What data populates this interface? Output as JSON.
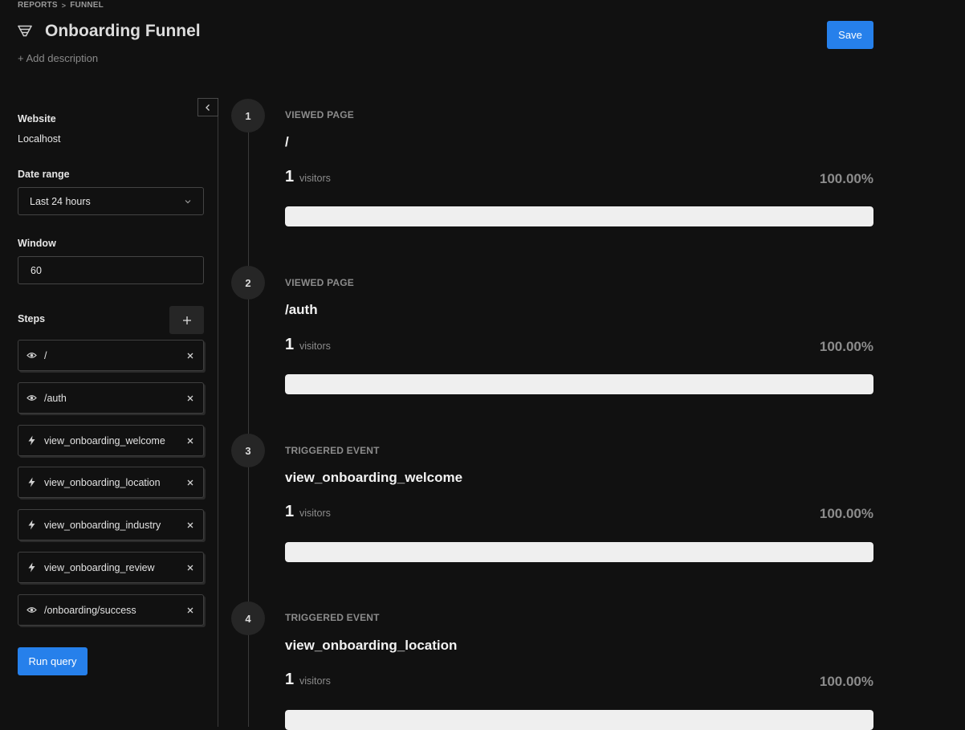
{
  "breadcrumb": {
    "parent": "REPORTS",
    "separator": ">",
    "current": "FUNNEL"
  },
  "header": {
    "title": "Onboarding Funnel",
    "icon": "funnel-icon",
    "add_description": "+ Add description",
    "save_label": "Save"
  },
  "sidebar": {
    "website_label": "Website",
    "website_value": "Localhost",
    "date_range_label": "Date range",
    "date_range_value": "Last 24 hours",
    "window_label": "Window",
    "window_value": "60",
    "steps_label": "Steps",
    "steps": [
      {
        "icon": "eye-icon",
        "value": "/"
      },
      {
        "icon": "eye-icon",
        "value": "/auth"
      },
      {
        "icon": "lightning-icon",
        "value": "view_onboarding_welcome"
      },
      {
        "icon": "lightning-icon",
        "value": "view_onboarding_location"
      },
      {
        "icon": "lightning-icon",
        "value": "view_onboarding_industry"
      },
      {
        "icon": "lightning-icon",
        "value": "view_onboarding_review"
      },
      {
        "icon": "eye-icon",
        "value": "/onboarding/success"
      }
    ],
    "run_label": "Run query"
  },
  "funnel": {
    "steps": [
      {
        "number": "1",
        "type": "VIEWED PAGE",
        "name": "/",
        "visitors": "1",
        "visitors_label": "visitors",
        "percent": "100.00%",
        "fill": 1.0
      },
      {
        "number": "2",
        "type": "VIEWED PAGE",
        "name": "/auth",
        "visitors": "1",
        "visitors_label": "visitors",
        "percent": "100.00%",
        "fill": 1.0
      },
      {
        "number": "3",
        "type": "TRIGGERED EVENT",
        "name": "view_onboarding_welcome",
        "visitors": "1",
        "visitors_label": "visitors",
        "percent": "100.00%",
        "fill": 1.0
      },
      {
        "number": "4",
        "type": "TRIGGERED EVENT",
        "name": "view_onboarding_location",
        "visitors": "1",
        "visitors_label": "visitors",
        "percent": "100.00%",
        "fill": 1.0
      }
    ]
  },
  "colors": {
    "accent": "#2680eb",
    "background": "#111111",
    "bar_fill": "#efefef"
  }
}
